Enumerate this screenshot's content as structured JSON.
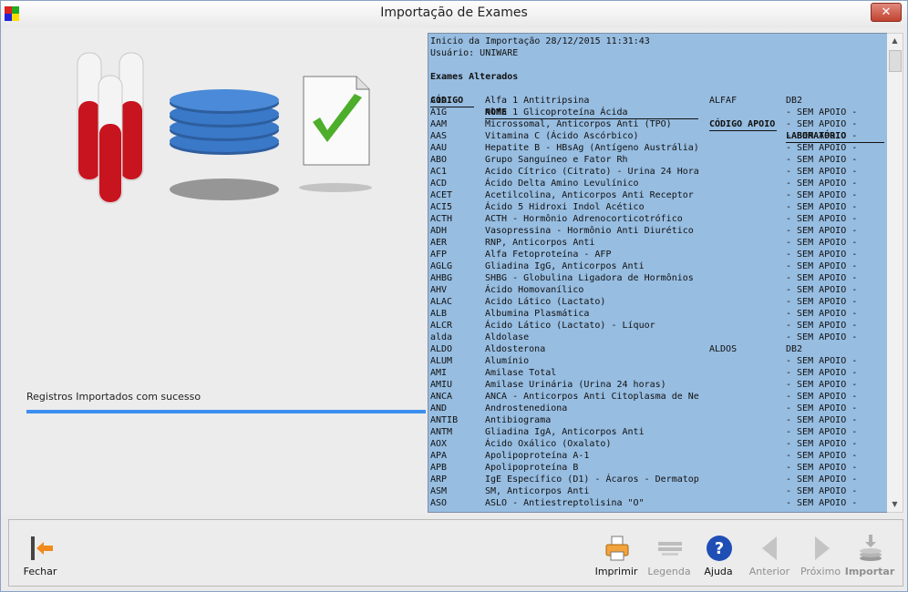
{
  "window": {
    "title": "Importação de Exames",
    "close_label": "✕"
  },
  "status": {
    "message": "Registros Importados com sucesso",
    "progress": 1.0
  },
  "log": {
    "start_line": "Inicio da Importação 28/12/2015 11:31:43",
    "user_line": "Usuário: UNIWARE",
    "section_title": "Exames Alterados",
    "columns": [
      "CÓDIGO",
      "NOME",
      "CÓDIGO APOIO",
      "LABORATÓRIO"
    ],
    "rows": [
      [
        "A1A",
        "Alfa 1 Antitripsina",
        "ALFAF",
        "DB2"
      ],
      [
        "A1G",
        "Alfa 1 Glicoproteína Ácida",
        "",
        "- SEM APOIO -"
      ],
      [
        "AAM",
        "Microssomal, Anticorpos Anti (TPO)",
        "",
        "- SEM APOIO -"
      ],
      [
        "AAS",
        "Vitamina C (Ácido Ascórbico)",
        "",
        "- SEM APOIO -"
      ],
      [
        "AAU",
        "Hepatite B - HBsAg (Antígeno Austrália)",
        "",
        "- SEM APOIO -"
      ],
      [
        "ABO",
        "Grupo Sanguíneo e Fator Rh",
        "",
        "- SEM APOIO -"
      ],
      [
        "AC1",
        "Acido Cítrico (Citrato) - Urina 24 Hora",
        "",
        "- SEM APOIO -"
      ],
      [
        "ACD",
        "Ácido Delta Amino Levulínico",
        "",
        "- SEM APOIO -"
      ],
      [
        "ACET",
        "Acetilcolina, Anticorpos Anti Receptor",
        "",
        "- SEM APOIO -"
      ],
      [
        "ACI5",
        "Ácido 5 Hidroxi Indol Acético",
        "",
        "- SEM APOIO -"
      ],
      [
        "ACTH",
        "ACTH - Hormônio Adrenocorticotrófico",
        "",
        "- SEM APOIO -"
      ],
      [
        "ADH",
        "Vasopressina - Hormônio Anti Diurético",
        "",
        "- SEM APOIO -"
      ],
      [
        "AER",
        "RNP, Anticorpos Anti",
        "",
        "- SEM APOIO -"
      ],
      [
        "AFP",
        "Alfa Fetoproteína - AFP",
        "",
        "- SEM APOIO -"
      ],
      [
        "AGLG",
        "Gliadina IgG, Anticorpos Anti",
        "",
        "- SEM APOIO -"
      ],
      [
        "AHBG",
        "SHBG - Globulina Ligadora de Hormônios",
        "",
        "- SEM APOIO -"
      ],
      [
        "AHV",
        "Ácido Homovanílico",
        "",
        "- SEM APOIO -"
      ],
      [
        "ALAC",
        "Acido Lático (Lactato)",
        "",
        "- SEM APOIO -"
      ],
      [
        "ALB",
        "Albumina Plasmática",
        "",
        "- SEM APOIO -"
      ],
      [
        "ALCR",
        "Ácido Lático (Lactato) - Líquor",
        "",
        "- SEM APOIO -"
      ],
      [
        "alda",
        "Aldolase",
        "",
        "- SEM APOIO -"
      ],
      [
        "ALDO",
        "Aldosterona",
        "ALDOS",
        "DB2"
      ],
      [
        "ALUM",
        "Alumínio",
        "",
        "- SEM APOIO -"
      ],
      [
        "AMI",
        "Amilase Total",
        "",
        "- SEM APOIO -"
      ],
      [
        "AMIU",
        "Amilase Urinária (Urina 24 horas)",
        "",
        "- SEM APOIO -"
      ],
      [
        "ANCA",
        "ANCA - Anticorpos Anti Citoplasma de Ne",
        "",
        "- SEM APOIO -"
      ],
      [
        "AND",
        "Androstenediona",
        "",
        "- SEM APOIO -"
      ],
      [
        "ANTIB",
        "Antibiograma",
        "",
        "- SEM APOIO -"
      ],
      [
        "ANTM",
        "Gliadina IgA, Anticorpos Anti",
        "",
        "- SEM APOIO -"
      ],
      [
        "AOX",
        "Ácido Oxálico (Oxalato)",
        "",
        "- SEM APOIO -"
      ],
      [
        "APA",
        "Apolipoproteína A-1",
        "",
        "- SEM APOIO -"
      ],
      [
        "APB",
        "Apolipoproteína B",
        "",
        "- SEM APOIO -"
      ],
      [
        "ARP",
        "IgE Específico (D1) - Ácaros - Dermatop",
        "",
        "- SEM APOIO -"
      ],
      [
        "ASM",
        "SM, Anticorpos Anti",
        "",
        "- SEM APOIO -"
      ],
      [
        "ASO",
        "ASLO - Antiestreptolisina \"O\"",
        "",
        "- SEM APOIO -"
      ]
    ]
  },
  "toolbar": {
    "fechar": "Fechar",
    "imprimir": "Imprimir",
    "legenda": "Legenda",
    "ajuda": "Ajuda",
    "anterior": "Anterior",
    "proximo": "Próximo",
    "importar": "Importar"
  },
  "colors": {
    "log_bg": "#97bde1",
    "progress": "#3c8ff0",
    "blood": "#c8141e",
    "disk": "#3a78c8",
    "check": "#4cae2a"
  }
}
